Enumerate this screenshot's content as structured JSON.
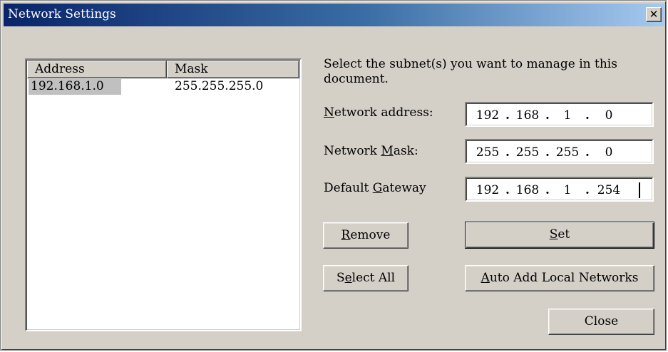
{
  "window": {
    "title": "Network Settings",
    "close_glyph": "✕"
  },
  "list": {
    "columns": [
      "Address",
      "Mask"
    ],
    "rows": [
      {
        "address": "192.168.1.0",
        "mask": "255.255.255.0"
      }
    ]
  },
  "instruction": "Select the subnet(s) you want to manage in this document.",
  "fields": {
    "network_address": {
      "label_mnemonic": "N",
      "label_rest": "etwork address:",
      "octets": [
        "192",
        "168",
        "1",
        "0"
      ]
    },
    "network_mask": {
      "label_before": "Network ",
      "label_mnemonic": "M",
      "label_rest": "ask:",
      "octets": [
        "255",
        "255",
        "255",
        "0"
      ]
    },
    "default_gateway": {
      "label_before": "Default ",
      "label_mnemonic": "G",
      "label_rest": "ateway",
      "octets": [
        "192",
        "168",
        "1",
        "254"
      ]
    }
  },
  "buttons": {
    "remove": {
      "mnemonic": "R",
      "rest": "emove"
    },
    "set": {
      "mnemonic": "S",
      "rest": "et"
    },
    "select_all": {
      "before": "S",
      "mnemonic": "e",
      "rest": "lect All"
    },
    "auto_add": {
      "mnemonic": "A",
      "rest": "uto Add Local Networks"
    },
    "close": "Close"
  },
  "ip_separator": "."
}
